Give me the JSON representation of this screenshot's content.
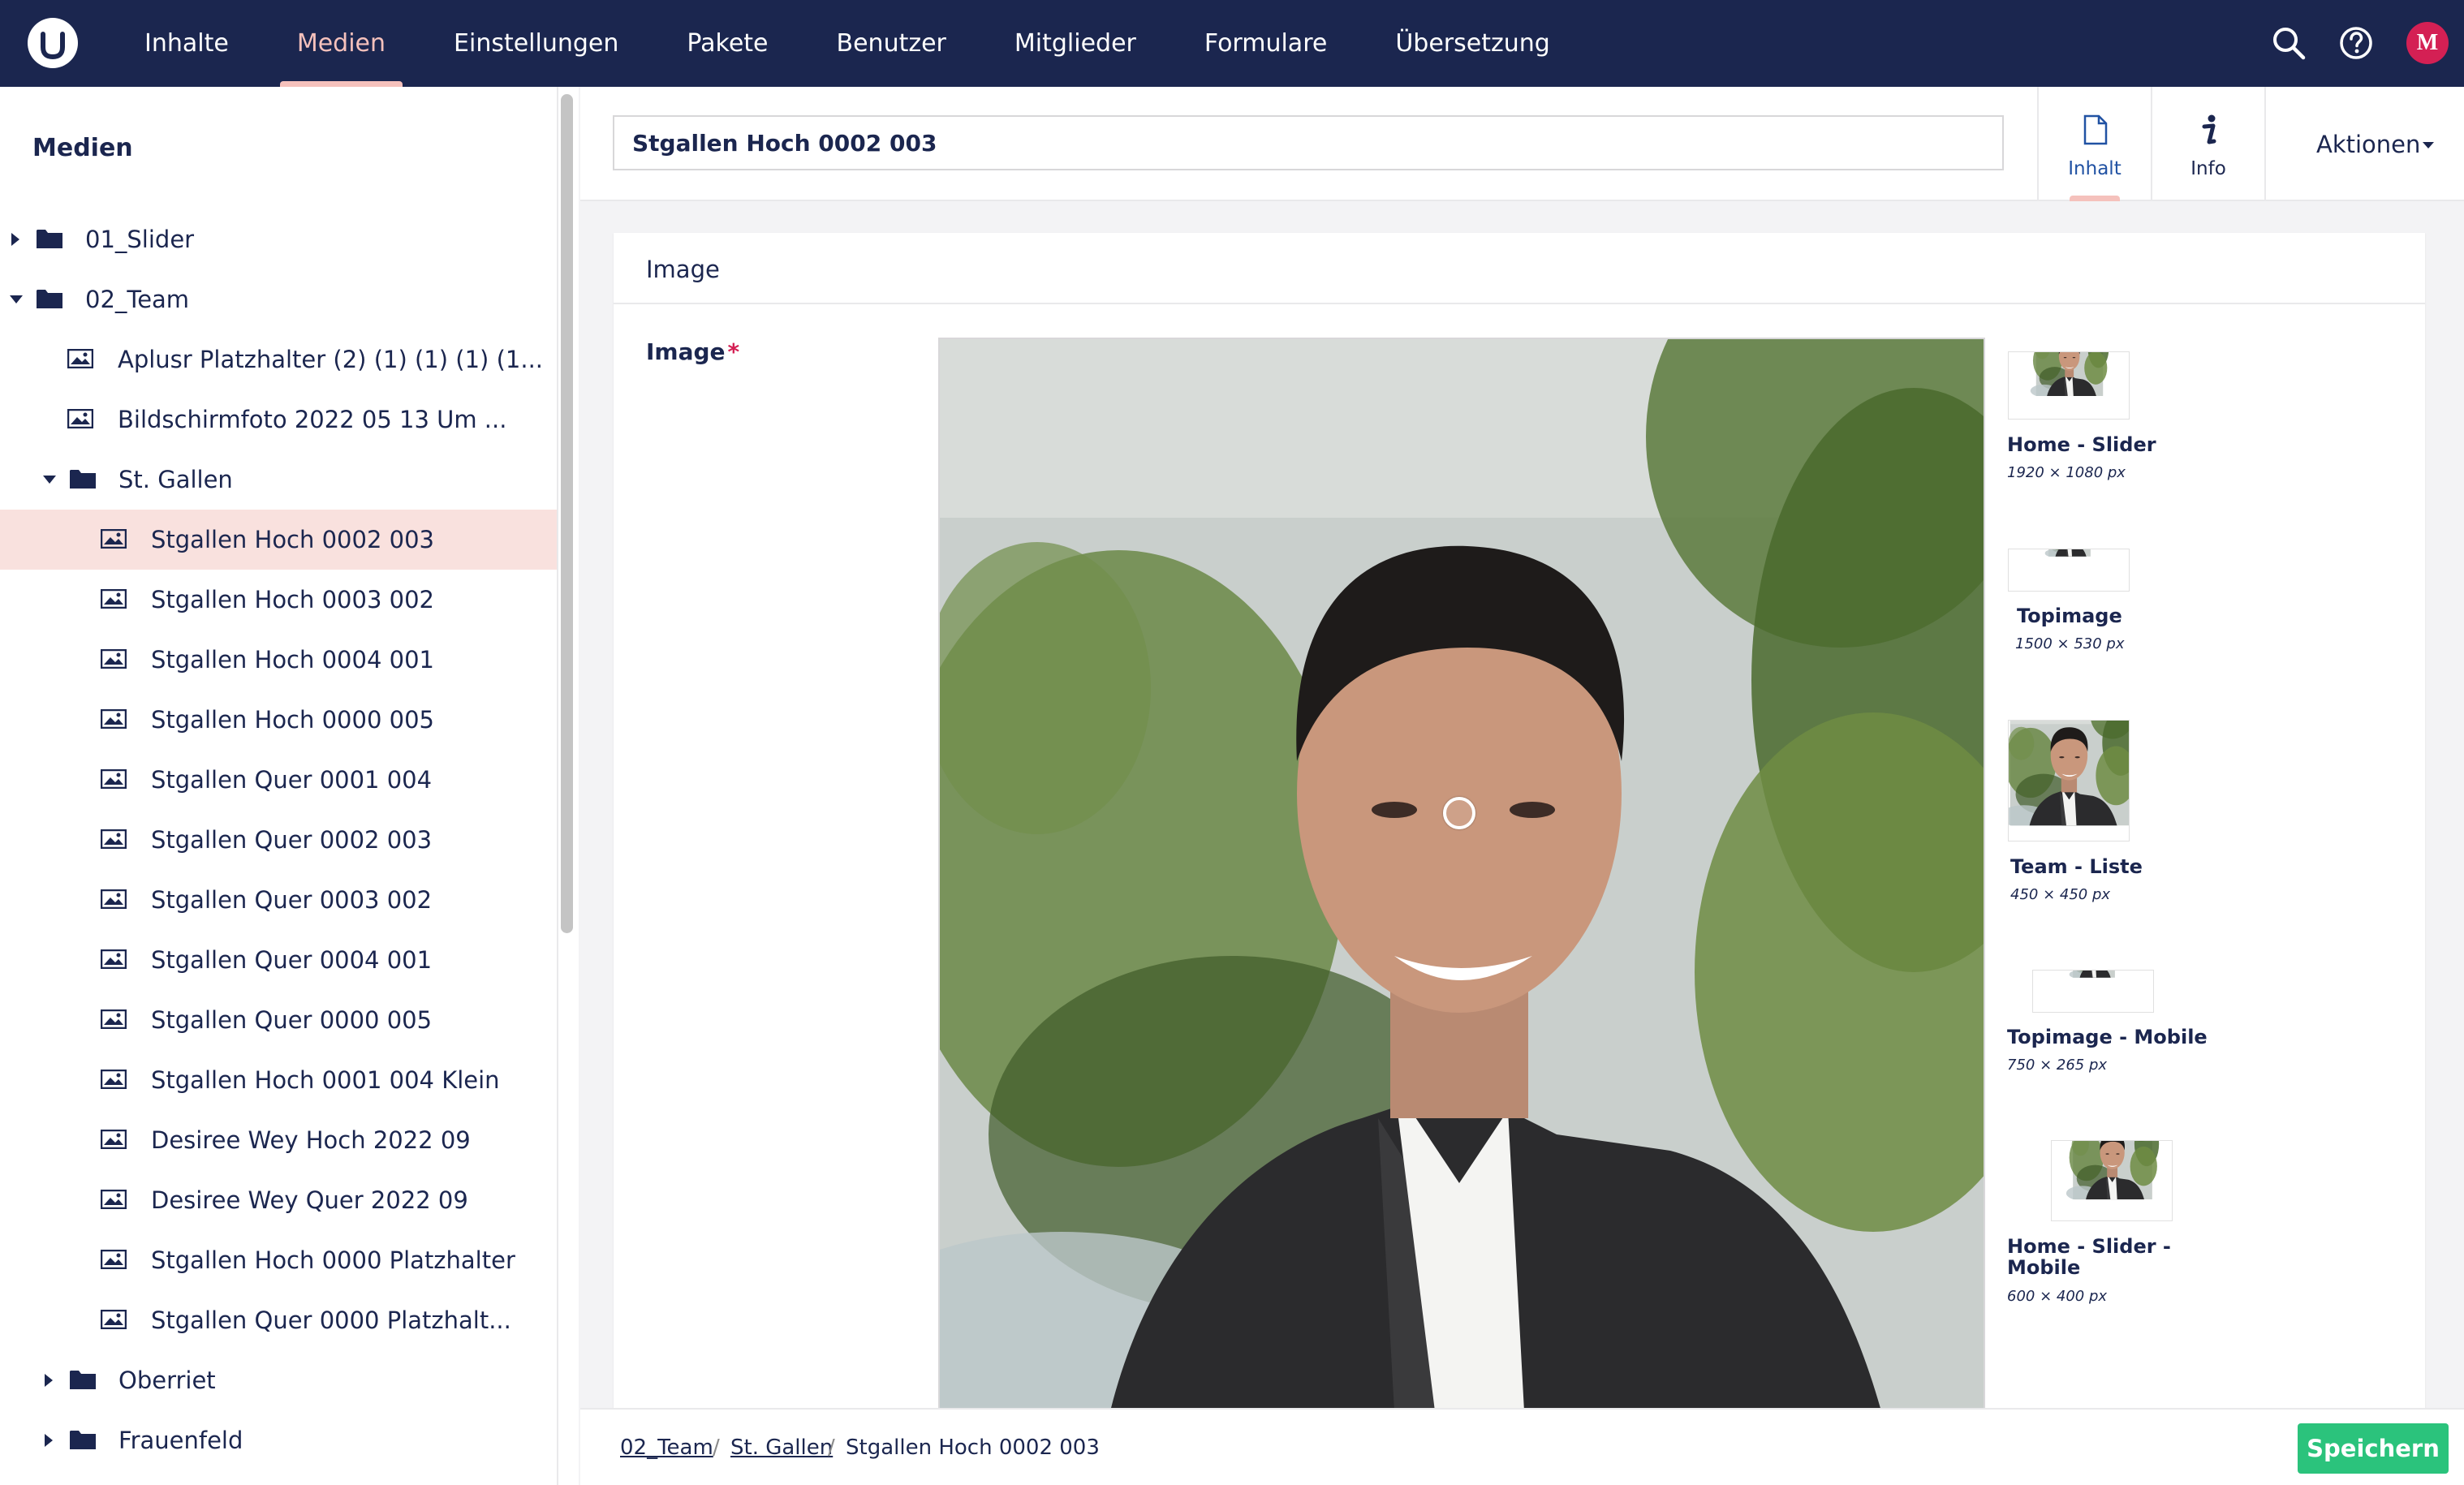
{
  "topnav": {
    "logo_icon": "umbraco-logo-icon",
    "items": [
      "Inhalte",
      "Medien",
      "Einstellungen",
      "Pakete",
      "Benutzer",
      "Mitglieder",
      "Formulare",
      "Übersetzung"
    ],
    "active": "Medien",
    "search_icon": "search-icon",
    "help_icon": "help-icon",
    "avatar_initials": "M"
  },
  "sidebar": {
    "title": "Medien",
    "tree": [
      {
        "label": "01_Slider",
        "type": "folder",
        "expanded": false
      },
      {
        "label": "02_Team",
        "type": "folder",
        "expanded": true
      },
      {
        "label": "Aplusr Platzhalter (2) (1) (1) (1) (1...",
        "type": "image"
      },
      {
        "label": "Bildschirmfoto 2022 05 13 Um ...",
        "type": "image"
      },
      {
        "label": "St. Gallen",
        "type": "folder",
        "expanded": true
      },
      {
        "label": "Stgallen Hoch 0002 003",
        "type": "image",
        "selected": true
      },
      {
        "label": "Stgallen Hoch 0003 002",
        "type": "image"
      },
      {
        "label": "Stgallen Hoch 0004 001",
        "type": "image"
      },
      {
        "label": "Stgallen Hoch 0000 005",
        "type": "image"
      },
      {
        "label": "Stgallen Quer 0001 004",
        "type": "image"
      },
      {
        "label": "Stgallen Quer 0002 003",
        "type": "image"
      },
      {
        "label": "Stgallen Quer 0003 002",
        "type": "image"
      },
      {
        "label": "Stgallen Quer 0004 001",
        "type": "image"
      },
      {
        "label": "Stgallen Quer 0000 005",
        "type": "image"
      },
      {
        "label": "Stgallen Hoch 0001 004 Klein",
        "type": "image"
      },
      {
        "label": "Desiree Wey Hoch 2022 09",
        "type": "image"
      },
      {
        "label": "Desiree Wey Quer 2022 09",
        "type": "image"
      },
      {
        "label": "Stgallen Hoch 0000 Platzhalter",
        "type": "image"
      },
      {
        "label": "Stgallen Quer 0000 Platzhalt...",
        "type": "image"
      },
      {
        "label": "Oberriet",
        "type": "folder",
        "expanded": false
      },
      {
        "label": "Frauenfeld",
        "type": "folder",
        "expanded": false
      }
    ]
  },
  "editor": {
    "name_value": "Stgallen Hoch 0002 003",
    "tabs": [
      {
        "label": "Inhalt",
        "icon": "document-icon",
        "active": true
      },
      {
        "label": "Info",
        "icon": "info-icon",
        "active": false
      }
    ],
    "actions_label": "Aktionen",
    "group_title": "Image",
    "property_label": "Image",
    "required_marker": "*",
    "crops": [
      {
        "name": "Home - Slider",
        "size": "1920 × 1080 px"
      },
      {
        "name": "Topimage",
        "size": "1500 × 530 px"
      },
      {
        "name": "Team - Liste",
        "size": "450 × 450 px"
      },
      {
        "name": "Topimage - Mobile",
        "size": "750 × 265 px"
      },
      {
        "name": "Home - Slider -",
        "name2": "Mobile",
        "size": "600 × 400 px"
      }
    ]
  },
  "footer": {
    "breadcrumb": [
      "02_Team",
      "St. Gallen",
      "Stgallen Hoch 0002 003"
    ],
    "separator": "/",
    "save_label": "Speichern"
  },
  "colors": {
    "topbar": "#1b264f",
    "accent_pink": "#f5c1bc",
    "selected_bg": "#f9e1de",
    "save_green": "#2bc37c",
    "required_red": "#d42054"
  }
}
